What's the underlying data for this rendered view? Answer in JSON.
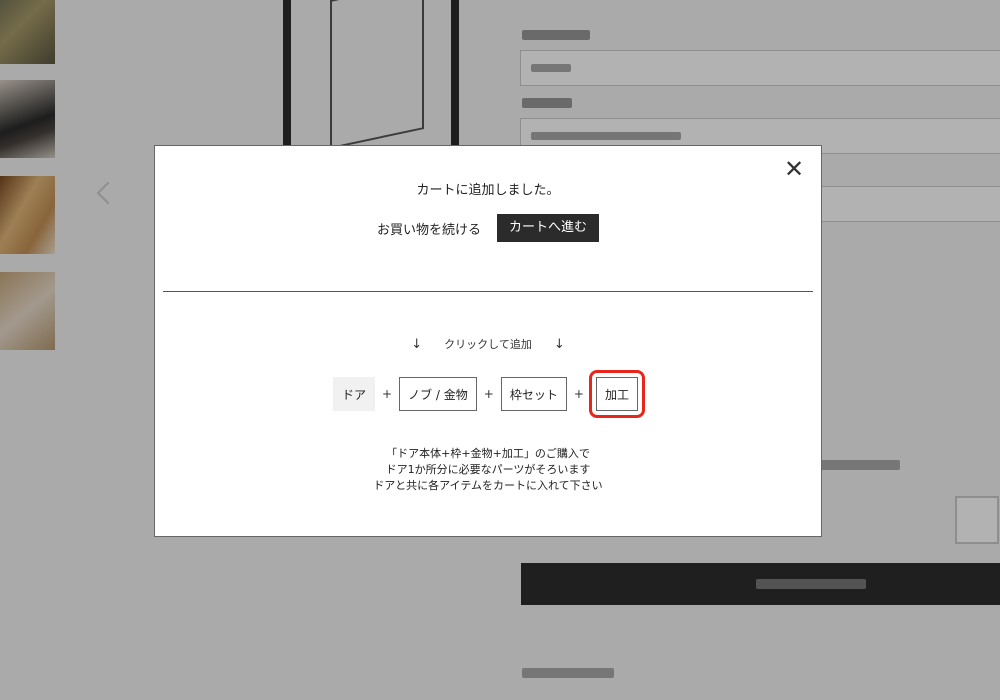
{
  "modal": {
    "message": "カートに追加しました。",
    "continue_label": "お買い物を続ける",
    "cart_label": "カートへ進む",
    "close_label": "✕",
    "hint": {
      "left_arrow": "↓",
      "text": "クリックして追加",
      "right_arrow": "↓"
    },
    "chips": [
      {
        "label": "ドア"
      },
      {
        "label": "ノブ / 金物"
      },
      {
        "label": "枠セット"
      },
      {
        "label": "加工"
      }
    ],
    "plus": "+",
    "description": [
      "「ドア本体+枠+金物+加工」のご購入で",
      "ドア1か所分に必要なパーツがそろいます",
      "ドアと共に各アイテムをカートに入れて下さい"
    ]
  },
  "colors": {
    "highlight": "#e8261b",
    "dark_button": "#2b2b2b",
    "overlay": "rgba(0,0,0,0.3)"
  }
}
